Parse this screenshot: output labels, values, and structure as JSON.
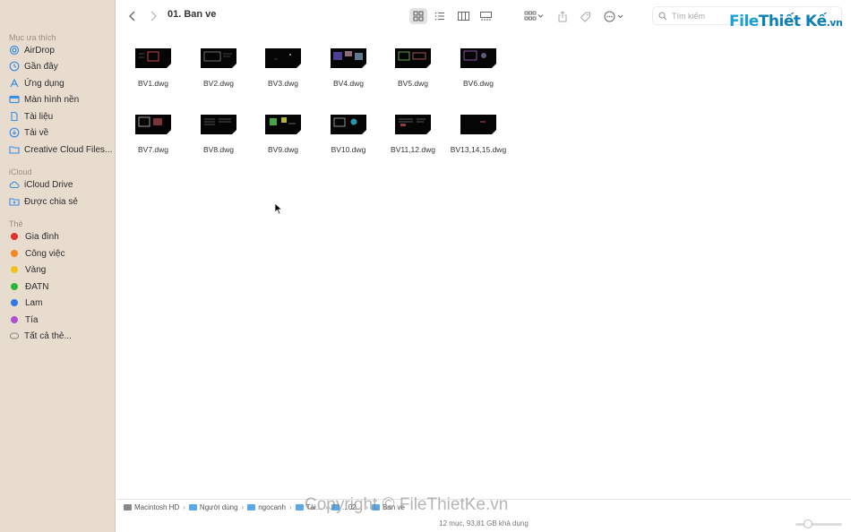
{
  "sidebar": {
    "section_favorites": "Mục ưa thích",
    "favorites": [
      {
        "label": "AirDrop",
        "icon": "airdrop-icon"
      },
      {
        "label": "Gần đây",
        "icon": "clock-icon"
      },
      {
        "label": "Ứng dụng",
        "icon": "apps-icon"
      },
      {
        "label": "Màn hình nền",
        "icon": "desktop-icon"
      },
      {
        "label": "Tài liệu",
        "icon": "document-icon"
      },
      {
        "label": "Tải về",
        "icon": "download-icon"
      },
      {
        "label": "Creative Cloud Files...",
        "icon": "folder-icon"
      }
    ],
    "section_icloud": "iCloud",
    "icloud": [
      {
        "label": "iCloud Drive",
        "icon": "cloud-icon"
      },
      {
        "label": "Được chia sẻ",
        "icon": "shared-folder-icon"
      }
    ],
    "section_tags": "Thẻ",
    "tags": [
      {
        "label": "Gia đình",
        "color": "#e0332e"
      },
      {
        "label": "Công việc",
        "color": "#f08a24"
      },
      {
        "label": "Vàng",
        "color": "#f2c21b"
      },
      {
        "label": "ĐATN",
        "color": "#2db53a"
      },
      {
        "label": "Lam",
        "color": "#2d7be0"
      },
      {
        "label": "Tía",
        "color": "#b04fd0"
      },
      {
        "label": "Tất cả thẻ...",
        "color": "outline"
      }
    ]
  },
  "toolbar": {
    "title": "01. Ban ve",
    "search_placeholder": "Tìm kiếm"
  },
  "brand": {
    "part1": "File",
    "part2": "Thiết Kế",
    "part3": ".vn"
  },
  "files": [
    {
      "name": "BV1.dwg"
    },
    {
      "name": "BV2.dwg"
    },
    {
      "name": "BV3.dwg"
    },
    {
      "name": "BV4.dwg"
    },
    {
      "name": "BV5.dwg"
    },
    {
      "name": "BV6.dwg"
    },
    {
      "name": "BV7.dwg"
    },
    {
      "name": "BV8.dwg"
    },
    {
      "name": "BV9.dwg"
    },
    {
      "name": "BV10.dwg"
    },
    {
      "name": "BV11,12.dwg"
    },
    {
      "name": "BV13,14,15.dwg"
    }
  ],
  "pathbar": {
    "crumbs": [
      "Macintosh HD",
      "Người dùng",
      "ngocanh",
      "Tài...",
      "...02...",
      "Ban ve"
    ]
  },
  "status": {
    "text": "12 mục, 93,81 GB khả dụng"
  },
  "watermark": "Copyright © FileThietKe.vn"
}
